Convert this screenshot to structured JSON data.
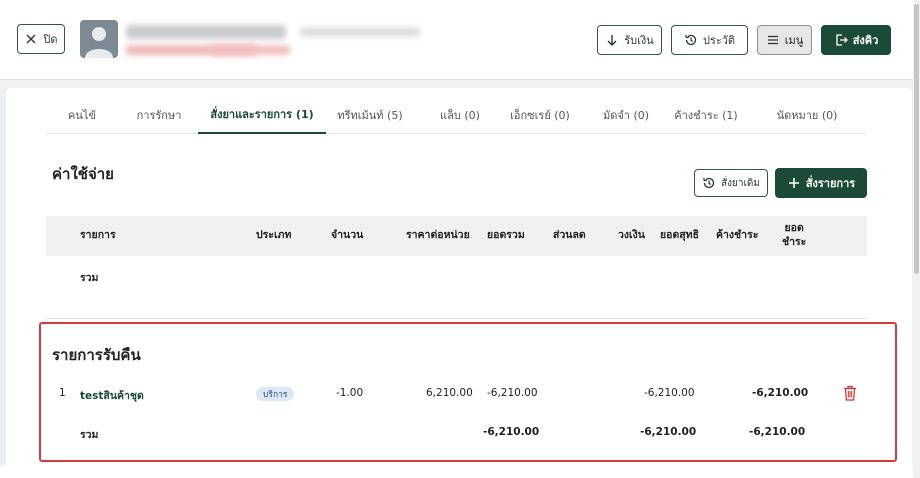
{
  "header": {
    "close_label": "ปิด",
    "receive_payment_label": "รับเงิน",
    "history_label": "ประวัติ",
    "menu_label": "เมนู",
    "send_queue_label": "ส่งคิว"
  },
  "tabs": [
    {
      "label": "คนไข้"
    },
    {
      "label": "การรักษา"
    },
    {
      "label": "สั่งยาและรายการ (1)"
    },
    {
      "label": "ทรีทเม้นท์ (5)"
    },
    {
      "label": "แล็บ (0)"
    },
    {
      "label": "เอ็กซเรย์ (0)"
    },
    {
      "label": "มัดจำ (0)"
    },
    {
      "label": "ค้างชำระ (1)"
    },
    {
      "label": "นัดหมาย (0)"
    }
  ],
  "expenses": {
    "title": "ค่าใช้จ่าย",
    "order_history_label": "สั่งยาเดิม",
    "add_item_label": "สั่งรายการ",
    "columns": {
      "item": "รายการ",
      "type": "ประเภท",
      "quantity": "จำนวน",
      "unit_price": "ราคาต่อหน่วย",
      "total": "ยอดรวม",
      "discount": "ส่วนลด",
      "limit": "วงเงิน",
      "net": "ยอดสุทธิ",
      "outstanding": "ค้างชำระ",
      "payable_line1": "ยอด",
      "payable_line2": "ชำระ"
    },
    "sum_label": "รวม"
  },
  "returns": {
    "title": "รายการรับคืน",
    "rows": [
      {
        "index": "1",
        "name": "testสินค้าชุด",
        "type": "บริการ",
        "quantity": "-1.00",
        "unit_price": "6,210.00",
        "total": "-6,210.00",
        "net": "-6,210.00",
        "payable": "-6,210.00"
      }
    ],
    "sum_label": "รวม",
    "sum_total": "-6,210.00",
    "sum_net": "-6,210.00",
    "sum_payable": "-6,210.00"
  },
  "colors": {
    "brand": "#1b4a36",
    "highlight_border": "#d9393e",
    "delete": "#c9302c"
  }
}
